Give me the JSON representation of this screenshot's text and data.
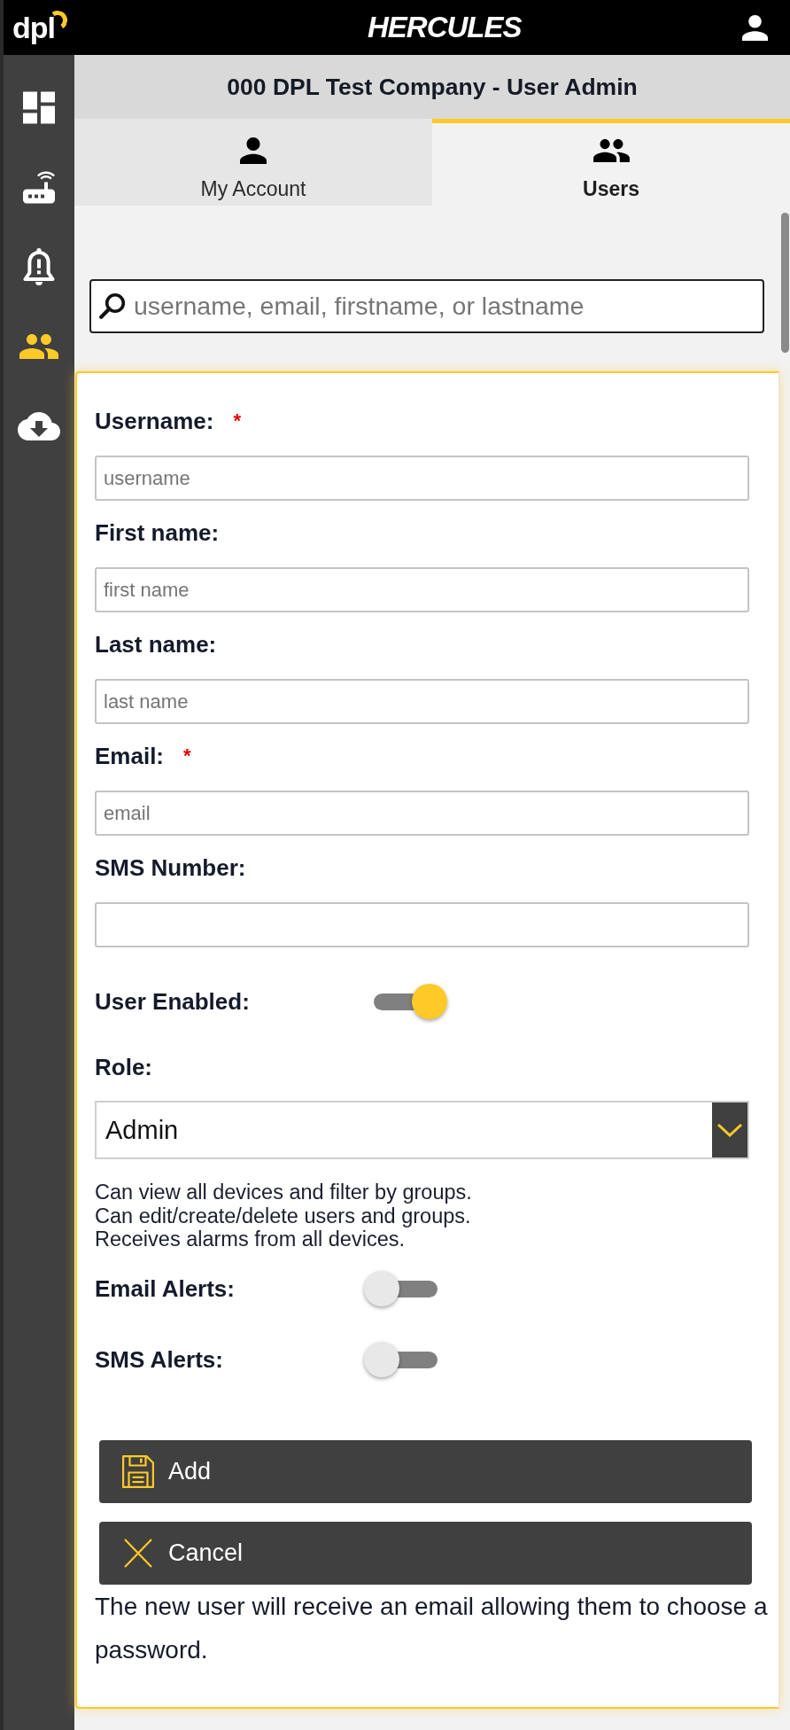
{
  "top_bar": {
    "logo": "dpl",
    "brand": "HERCULES"
  },
  "sidebar": {
    "items": [
      {
        "selected": false
      },
      {
        "selected": false
      },
      {
        "selected": false
      },
      {
        "selected": true
      },
      {
        "selected": false
      }
    ]
  },
  "header": {
    "title": "000 DPL Test Company - User Admin"
  },
  "tabs": [
    {
      "label": "My Account",
      "selected": false
    },
    {
      "label": "Users",
      "selected": true
    }
  ],
  "search": {
    "placeholder": "username, email, firstname, or lastname"
  },
  "form": {
    "required_mark": "*",
    "rows": [
      {
        "kind": "text",
        "label": "Username:",
        "required": true,
        "placeholder": "username"
      },
      {
        "kind": "text",
        "label": "First name:",
        "required": false,
        "placeholder": "first name"
      },
      {
        "kind": "text",
        "label": "Last name:",
        "required": false,
        "placeholder": "last name"
      },
      {
        "kind": "text",
        "label": "Email:",
        "required": true,
        "placeholder": "email"
      },
      {
        "kind": "text",
        "label": "SMS Number:",
        "required": false
      },
      {
        "kind": "toggle",
        "label": "User Enabled:",
        "on": true
      },
      {
        "kind": "select",
        "label": "Role:",
        "value": "Admin",
        "description": [
          "Can view all devices and filter by groups.",
          "Can edit/create/delete users and groups.",
          "Receives alarms from all devices."
        ]
      },
      {
        "kind": "toggle",
        "label": "Email Alerts:",
        "on": false
      },
      {
        "kind": "toggle",
        "label": "SMS Alerts:",
        "on": false
      }
    ],
    "buttons": [
      {
        "kind": "save",
        "label": "Add"
      },
      {
        "kind": "cancel",
        "label": "Cancel"
      }
    ],
    "note": "The new user will receive an email allowing them to choose a password."
  }
}
